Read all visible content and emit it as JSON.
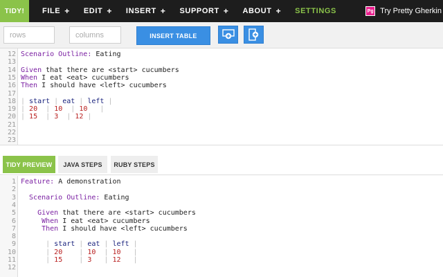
{
  "nav": {
    "logo": "TIDY!",
    "items": [
      {
        "label": "FILE",
        "plus": "+"
      },
      {
        "label": "EDIT",
        "plus": "+"
      },
      {
        "label": "INSERT",
        "plus": "+"
      },
      {
        "label": "SUPPORT",
        "plus": "+"
      },
      {
        "label": "ABOUT",
        "plus": "+"
      }
    ],
    "settings": "SETTINGS",
    "promo_badge": "Pg",
    "promo_text": "Try Pretty Gherkin"
  },
  "toolbar": {
    "rows_placeholder": "rows",
    "columns_placeholder": "columns",
    "insert_table_label": "INSERT TABLE"
  },
  "editor": {
    "lines": [
      {
        "n": "12",
        "parts": [
          {
            "t": "Scenario Outline: ",
            "c": "kw"
          },
          {
            "t": "Eating",
            "c": ""
          }
        ]
      },
      {
        "n": "13",
        "parts": []
      },
      {
        "n": "14",
        "parts": [
          {
            "t": "Given",
            "c": "kw"
          },
          {
            "t": " that there are <start> cucumbers",
            "c": ""
          }
        ]
      },
      {
        "n": "15",
        "parts": [
          {
            "t": "When",
            "c": "kw"
          },
          {
            "t": " I eat <eat> cucumbers",
            "c": ""
          }
        ]
      },
      {
        "n": "16",
        "parts": [
          {
            "t": "Then",
            "c": "kw"
          },
          {
            "t": " I should have <left> cucumbers",
            "c": ""
          }
        ]
      },
      {
        "n": "17",
        "parts": []
      },
      {
        "n": "18",
        "parts": [
          {
            "t": "| ",
            "c": "pipe"
          },
          {
            "t": "start",
            "c": "hd"
          },
          {
            "t": " | ",
            "c": "pipe"
          },
          {
            "t": "eat",
            "c": "hd"
          },
          {
            "t": " | ",
            "c": "pipe"
          },
          {
            "t": "left",
            "c": "hd"
          },
          {
            "t": " |",
            "c": "pipe"
          }
        ]
      },
      {
        "n": "19",
        "parts": [
          {
            "t": "| ",
            "c": "pipe"
          },
          {
            "t": "20",
            "c": "num"
          },
          {
            "t": "  | ",
            "c": "pipe"
          },
          {
            "t": "10",
            "c": "num"
          },
          {
            "t": "  | ",
            "c": "pipe"
          },
          {
            "t": "10",
            "c": "num"
          },
          {
            "t": "   |",
            "c": "pipe"
          }
        ]
      },
      {
        "n": "20",
        "parts": [
          {
            "t": "| ",
            "c": "pipe"
          },
          {
            "t": "15",
            "c": "num"
          },
          {
            "t": "  | ",
            "c": "pipe"
          },
          {
            "t": "3",
            "c": "num"
          },
          {
            "t": "  | ",
            "c": "pipe"
          },
          {
            "t": "12",
            "c": "num"
          },
          {
            "t": " |",
            "c": "pipe"
          }
        ]
      },
      {
        "n": "21",
        "parts": []
      },
      {
        "n": "22",
        "parts": []
      },
      {
        "n": "23",
        "parts": []
      }
    ]
  },
  "tabs": [
    {
      "label": "TIDY PREVIEW",
      "active": true
    },
    {
      "label": "JAVA STEPS",
      "active": false
    },
    {
      "label": "RUBY STEPS",
      "active": false
    }
  ],
  "preview": {
    "lines": [
      {
        "n": "1",
        "parts": [
          {
            "t": "Feature: ",
            "c": "kw"
          },
          {
            "t": "A demonstration",
            "c": ""
          }
        ]
      },
      {
        "n": "2",
        "parts": []
      },
      {
        "n": "3",
        "parts": [
          {
            "t": "  Scenario Outline: ",
            "c": "kw"
          },
          {
            "t": "Eating",
            "c": ""
          }
        ]
      },
      {
        "n": "4",
        "parts": []
      },
      {
        "n": "5",
        "parts": [
          {
            "t": "    Given",
            "c": "kw"
          },
          {
            "t": " that there are <start> cucumbers",
            "c": ""
          }
        ]
      },
      {
        "n": "6",
        "parts": [
          {
            "t": "     When",
            "c": "kw"
          },
          {
            "t": " I eat <eat> cucumbers",
            "c": ""
          }
        ]
      },
      {
        "n": "7",
        "parts": [
          {
            "t": "     Then",
            "c": "kw"
          },
          {
            "t": " I should have <left> cucumbers",
            "c": ""
          }
        ]
      },
      {
        "n": "8",
        "parts": []
      },
      {
        "n": "9",
        "parts": [
          {
            "t": "      | ",
            "c": "pipe"
          },
          {
            "t": "start",
            "c": "hd"
          },
          {
            "t": " | ",
            "c": "pipe"
          },
          {
            "t": "eat",
            "c": "hd"
          },
          {
            "t": " | ",
            "c": "pipe"
          },
          {
            "t": "left",
            "c": "hd"
          },
          {
            "t": " |",
            "c": "pipe"
          }
        ]
      },
      {
        "n": "10",
        "parts": [
          {
            "t": "      | ",
            "c": "pipe"
          },
          {
            "t": "20",
            "c": "num"
          },
          {
            "t": "    | ",
            "c": "pipe"
          },
          {
            "t": "10",
            "c": "num"
          },
          {
            "t": "  | ",
            "c": "pipe"
          },
          {
            "t": "10",
            "c": "num"
          },
          {
            "t": "   |",
            "c": "pipe"
          }
        ]
      },
      {
        "n": "11",
        "parts": [
          {
            "t": "      | ",
            "c": "pipe"
          },
          {
            "t": "15",
            "c": "num"
          },
          {
            "t": "    | ",
            "c": "pipe"
          },
          {
            "t": "3",
            "c": "num"
          },
          {
            "t": "   | ",
            "c": "pipe"
          },
          {
            "t": "12",
            "c": "num"
          },
          {
            "t": "   |",
            "c": "pipe"
          }
        ]
      },
      {
        "n": "12",
        "parts": []
      }
    ]
  },
  "colors": {
    "accent_green": "#8bc34a",
    "button_blue": "#3a8fe3",
    "nav_bg": "#1d1d1d",
    "promo_pink": "#e91e8c"
  }
}
